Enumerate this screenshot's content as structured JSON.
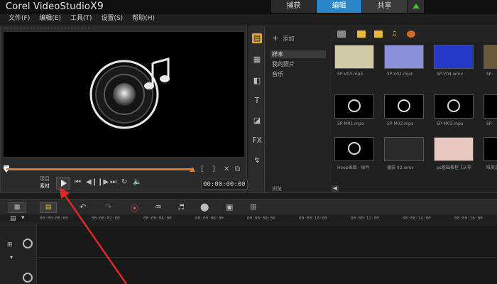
{
  "app": {
    "title_prefix": "Corel ",
    "title_main": "VideoStudio",
    "title_version": "X9"
  },
  "tabs": [
    {
      "label": "捕获",
      "active": false
    },
    {
      "label": "编辑",
      "active": true
    },
    {
      "label": "共享",
      "active": false
    }
  ],
  "menu": [
    "文件(F)",
    "编辑(E)",
    "工具(T)",
    "设置(S)",
    "帮助(H)"
  ],
  "player": {
    "mode_labels": {
      "project": "项目",
      "clip": "素材"
    },
    "timecode": "00:00:00:00",
    "bracket_in": "[",
    "bracket_out": "]"
  },
  "library": {
    "add_label": "添加",
    "folders": [
      {
        "label": "样本",
        "selected": true
      },
      {
        "label": "我的照片",
        "selected": false
      },
      {
        "label": "音乐",
        "selected": false
      }
    ],
    "browse_label": "浏览",
    "thumbnails": [
      {
        "label": "SP-V03.mp4",
        "color": "#cfc9a8"
      },
      {
        "label": "SP-V02.mp4",
        "color": "#8a90d8"
      },
      {
        "label": "SP-V04.wmv",
        "color": "#2438c8"
      },
      {
        "label": "SP-",
        "color": "#6a5a3a"
      },
      {
        "label": "SP-M01.mpa",
        "color": "#000000"
      },
      {
        "label": "SP-M02.mpa",
        "color": "#000000"
      },
      {
        "label": "SP-M03.mpa",
        "color": "#000000"
      },
      {
        "label": "SP-",
        "color": "#000000"
      },
      {
        "label": "Hoop画面 · 插件",
        "color": "#000000"
      },
      {
        "label": "播获 02.wmv",
        "color": "#2a2a2a"
      },
      {
        "label": "ps基础教程【从零",
        "color": "#e8c8c0"
      },
      {
        "label": "唯美游",
        "color": "#000000"
      }
    ]
  },
  "timeline": {
    "ticks": [
      "00:00:00:00",
      "00:00:02:00",
      "00:00:04:00",
      "00:00:06:00",
      "00:00:08:00",
      "00:00:10:00",
      "00:00:12:00",
      "00:00:14:00",
      "00:00:16:00"
    ]
  },
  "icons": {
    "storyboard": "film-icon",
    "timeline": "timeline-icon",
    "undo": "undo-icon",
    "redo": "redo-icon",
    "play": "play-icon",
    "music_note": "music-note-icon"
  },
  "colors": {
    "accent_blue": "#2a86c8",
    "scrub_orange": "#e07a2a",
    "folder_selected": "#e8a82a",
    "annotation_red": "#e02828"
  }
}
